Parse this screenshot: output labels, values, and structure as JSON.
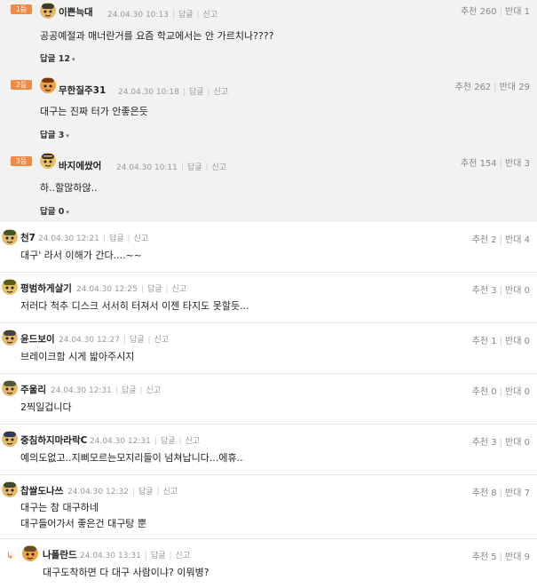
{
  "best_comments": [
    {
      "rank": "1등",
      "nick": "이쁜늑대",
      "date": "24.04.30 10:13",
      "reply_label": "답글",
      "report_label": "신고",
      "up_label": "추천",
      "up": "260",
      "down_label": "반대",
      "down": "1",
      "content": "공공예절과 매너란거를 요즘 학교에서는 안 가르치나????",
      "replies": "답글 12"
    },
    {
      "rank": "2등",
      "nick": "무한질주31",
      "date": "24.04.30 10:18",
      "reply_label": "답글",
      "report_label": "신고",
      "up_label": "추천",
      "up": "262",
      "down_label": "반대",
      "down": "29",
      "content": "대구는 진짜 터가 안좋은듯",
      "replies": "답글 3"
    },
    {
      "rank": "3등",
      "nick": "바지에쌌어",
      "date": "24.04.30 10:11",
      "reply_label": "답글",
      "report_label": "신고",
      "up_label": "추천",
      "up": "154",
      "down_label": "반대",
      "down": "3",
      "content": "하..할많하않..",
      "replies": "답글 0"
    }
  ],
  "comments": [
    {
      "nick": "천7",
      "date": "24.04.30 12:21",
      "reply_label": "답글",
      "report_label": "신고",
      "up_label": "추천",
      "up": "2",
      "down_label": "반대",
      "down": "4",
      "lines": [
        "대구' 라서 이해가 간다....~~"
      ]
    },
    {
      "nick": "평범하게살기",
      "date": "24.04.30 12:25",
      "reply_label": "답글",
      "report_label": "신고",
      "up_label": "추천",
      "up": "3",
      "down_label": "반대",
      "down": "0",
      "lines": [
        "저러다 척추 디스크 서서히 터져서 이젠 타지도 못할듯..."
      ]
    },
    {
      "nick": "윤드보이",
      "date": "24.04.30 12:27",
      "reply_label": "답글",
      "report_label": "신고",
      "up_label": "추천",
      "up": "1",
      "down_label": "반대",
      "down": "0",
      "lines": [
        "브레이크함 시게 밟아주시지"
      ]
    },
    {
      "nick": "주울리",
      "date": "24.04.30 12:31",
      "reply_label": "답글",
      "report_label": "신고",
      "up_label": "추천",
      "up": "0",
      "down_label": "반대",
      "down": "0",
      "lines": [
        "2찍일겁니다"
      ]
    },
    {
      "nick": "중침하지마라락C",
      "date": "24.04.30 12:31",
      "reply_label": "답글",
      "report_label": "신고",
      "up_label": "추천",
      "up": "3",
      "down_label": "반대",
      "down": "0",
      "lines": [
        "예의도없고..지삐모르는모지리들이 넘쳐납니다...에휴.."
      ]
    },
    {
      "nick": "찹쌀도나쓰",
      "date": "24.04.30 12:32",
      "reply_label": "답글",
      "report_label": "신고",
      "up_label": "추천",
      "up": "8",
      "down_label": "반대",
      "down": "7",
      "lines": [
        "대구는 참 대구하네",
        "대구들어가서 좋은건 대구탕 뿐"
      ]
    },
    {
      "nick": "나폴란드",
      "date": "24.04.30 13:31",
      "reply_label": "답글",
      "report_label": "신고",
      "up_label": "추천",
      "up": "5",
      "down_label": "반대",
      "down": "9",
      "lines": [
        "대구도착하면 다 대구 사람이냐? 이뭐병?"
      ],
      "is_reply": true
    }
  ]
}
